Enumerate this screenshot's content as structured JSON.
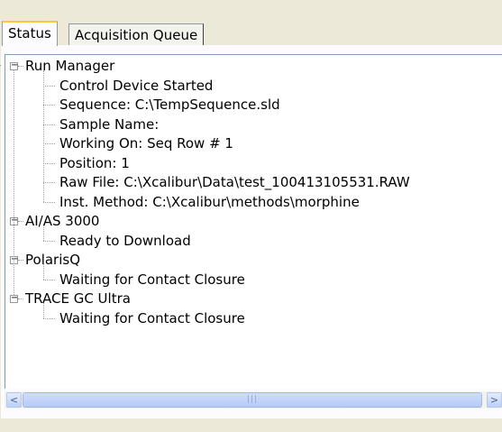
{
  "tabs": [
    {
      "label": "Status",
      "active": true
    },
    {
      "label": "Acquisition Queue",
      "active": false
    }
  ],
  "tree": {
    "nodes": [
      {
        "label": "Run Manager",
        "expanded": true,
        "children": [
          "Control Device Started",
          "Sequence: C:\\TempSequence.sld",
          "Sample Name:",
          "Working On: Seq Row # 1",
          "Position: 1",
          "Raw File: C:\\Xcalibur\\Data\\test_100413105531.RAW",
          "Inst. Method: C:\\Xcalibur\\methods\\morphine"
        ]
      },
      {
        "label": "AI/AS 3000",
        "expanded": true,
        "children": [
          "Ready to Download"
        ]
      },
      {
        "label": "PolarisQ",
        "expanded": true,
        "children": [
          "Waiting for Contact Closure"
        ]
      },
      {
        "label": "TRACE GC Ultra",
        "expanded": true,
        "children": [
          "Waiting for Contact Closure"
        ]
      }
    ],
    "expander_symbol": "−"
  },
  "scrollbar": {
    "left_arrow": "<",
    "right_arrow": ">",
    "thumb_grip": "|||"
  }
}
